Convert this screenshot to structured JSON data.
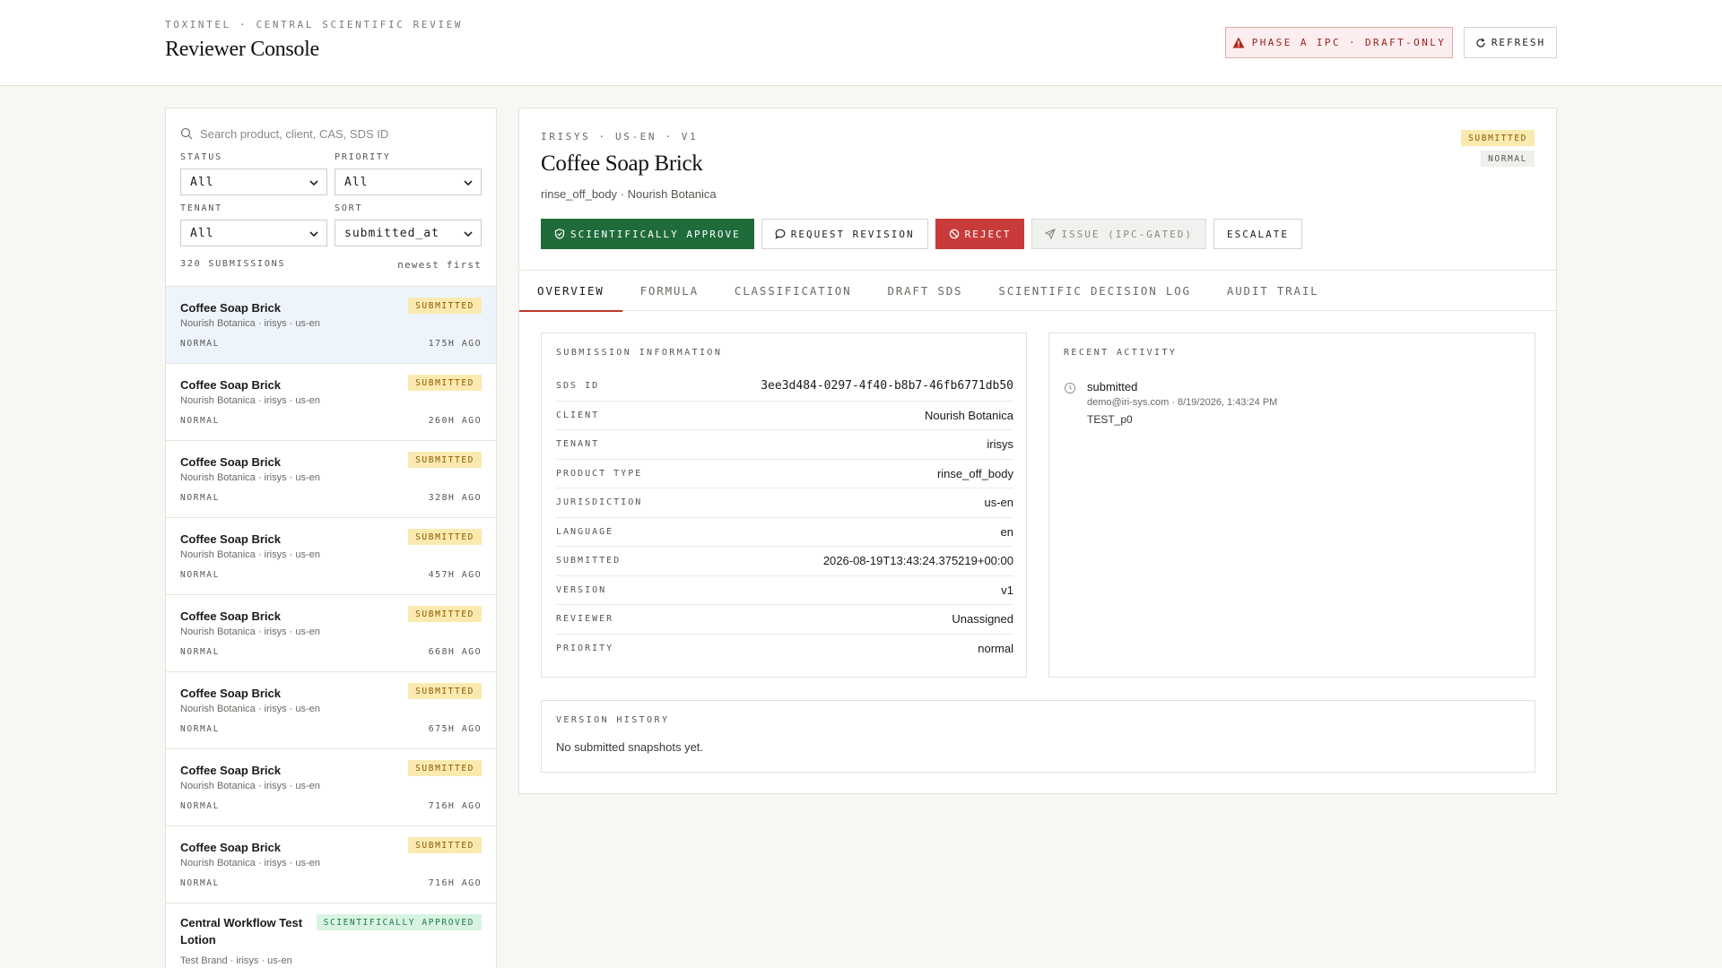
{
  "header": {
    "eyebrow": "TOXINTEL · CENTRAL SCIENTIFIC REVIEW",
    "title": "Reviewer Console",
    "phase_badge": "PHASE A IPC · DRAFT-ONLY",
    "refresh_label": "REFRESH"
  },
  "filters": {
    "search_placeholder": "Search product, client, CAS, SDS ID",
    "status_label": "STATUS",
    "status_value": "All",
    "priority_label": "PRIORITY",
    "priority_value": "All",
    "tenant_label": "TENANT",
    "tenant_value": "All",
    "sort_label": "SORT",
    "sort_value": "submitted_at",
    "count": "320 SUBMISSIONS",
    "sort_hint": "newest first"
  },
  "submissions": [
    {
      "title": "Coffee Soap Brick",
      "subtitle": "Nourish Botanica · irisys · us-en",
      "status": "SUBMITTED",
      "priority": "NORMAL",
      "age": "175H AGO"
    },
    {
      "title": "Coffee Soap Brick",
      "subtitle": "Nourish Botanica · irisys · us-en",
      "status": "SUBMITTED",
      "priority": "NORMAL",
      "age": "260H AGO"
    },
    {
      "title": "Coffee Soap Brick",
      "subtitle": "Nourish Botanica · irisys · us-en",
      "status": "SUBMITTED",
      "priority": "NORMAL",
      "age": "328H AGO"
    },
    {
      "title": "Coffee Soap Brick",
      "subtitle": "Nourish Botanica · irisys · us-en",
      "status": "SUBMITTED",
      "priority": "NORMAL",
      "age": "457H AGO"
    },
    {
      "title": "Coffee Soap Brick",
      "subtitle": "Nourish Botanica · irisys · us-en",
      "status": "SUBMITTED",
      "priority": "NORMAL",
      "age": "668H AGO"
    },
    {
      "title": "Coffee Soap Brick",
      "subtitle": "Nourish Botanica · irisys · us-en",
      "status": "SUBMITTED",
      "priority": "NORMAL",
      "age": "675H AGO"
    },
    {
      "title": "Coffee Soap Brick",
      "subtitle": "Nourish Botanica · irisys · us-en",
      "status": "SUBMITTED",
      "priority": "NORMAL",
      "age": "716H AGO"
    },
    {
      "title": "Coffee Soap Brick",
      "subtitle": "Nourish Botanica · irisys · us-en",
      "status": "SUBMITTED",
      "priority": "NORMAL",
      "age": "716H AGO"
    },
    {
      "title": "Central Workflow Test Lotion",
      "subtitle": "Test Brand · irisys · us-en",
      "status": "SCIENTIFICALLY APPROVED",
      "priority": "",
      "age": ""
    }
  ],
  "detail": {
    "eyebrow": "IRISYS · US-EN · V1",
    "title": "Coffee Soap Brick",
    "subtitle": "rinse_off_body · Nourish Botanica",
    "status_chip": "SUBMITTED",
    "priority_chip": "NORMAL",
    "actions": {
      "approve": "SCIENTIFICALLY APPROVE",
      "revision": "REQUEST REVISION",
      "reject": "REJECT",
      "issue": "ISSUE (IPC-GATED)",
      "escalate": "ESCALATE"
    },
    "tabs": [
      "OVERVIEW",
      "FORMULA",
      "CLASSIFICATION",
      "DRAFT SDS",
      "SCIENTIFIC DECISION LOG",
      "AUDIT TRAIL"
    ],
    "info_title": "SUBMISSION INFORMATION",
    "info": [
      {
        "key": "SDS ID",
        "value": "3ee3d484-0297-4f40-b8b7-46fb6771db50"
      },
      {
        "key": "CLIENT",
        "value": "Nourish Botanica"
      },
      {
        "key": "TENANT",
        "value": "irisys"
      },
      {
        "key": "PRODUCT TYPE",
        "value": "rinse_off_body"
      },
      {
        "key": "JURISDICTION",
        "value": "us-en"
      },
      {
        "key": "LANGUAGE",
        "value": "en"
      },
      {
        "key": "SUBMITTED",
        "value": "2026-08-19T13:43:24.375219+00:00"
      },
      {
        "key": "VERSION",
        "value": "v1"
      },
      {
        "key": "REVIEWER",
        "value": "Unassigned"
      },
      {
        "key": "PRIORITY",
        "value": "normal"
      }
    ],
    "activity_title": "RECENT ACTIVITY",
    "activity": {
      "title": "submitted",
      "meta": "demo@iri-sys.com · 8/19/2026, 1:43:24 PM",
      "note": "TEST_p0"
    },
    "version_title": "VERSION HISTORY",
    "version_text": "No submitted snapshots yet."
  },
  "colors": {
    "approve": "#1f6b3a",
    "reject": "#c93b3b",
    "submitted_chip": "#fbeab0",
    "approved_chip": "#d8f3e2",
    "active_tab": "#c0392b"
  }
}
